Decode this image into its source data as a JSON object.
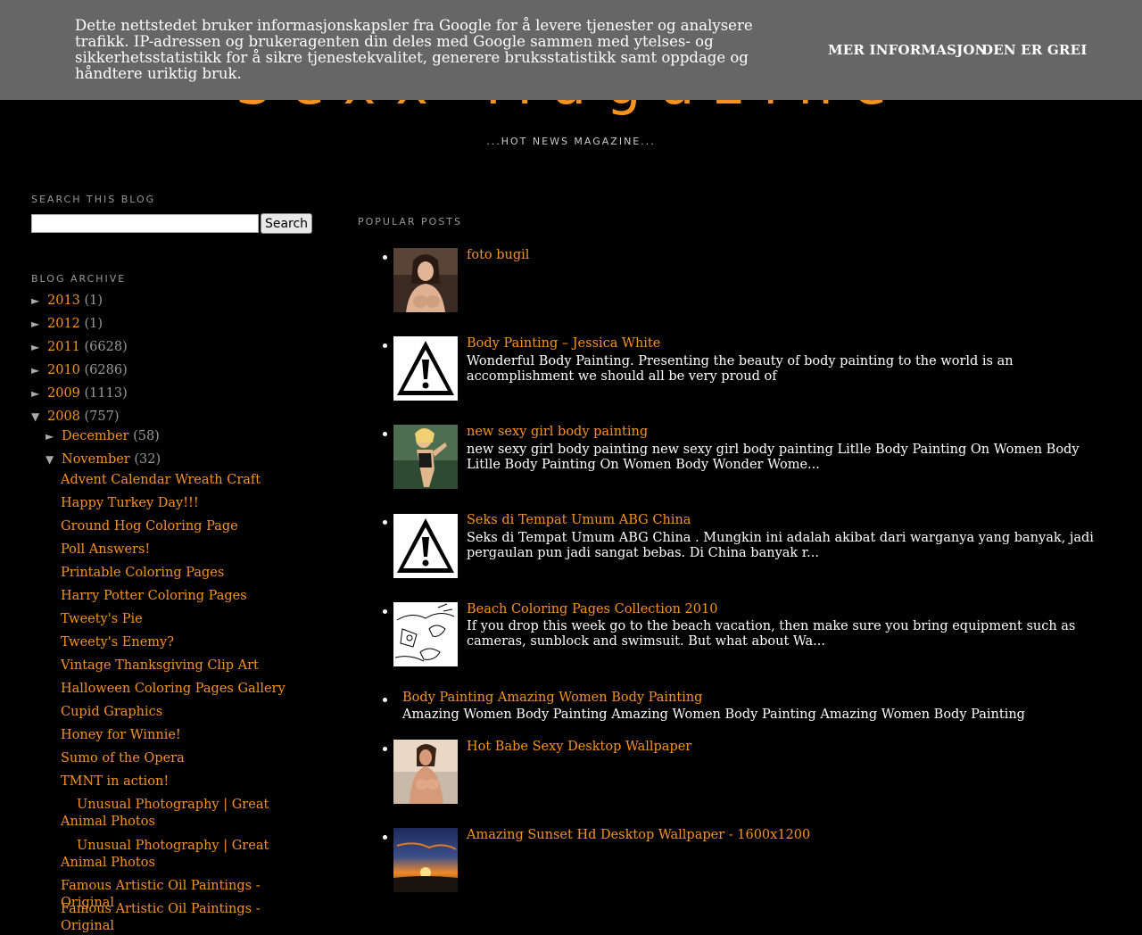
{
  "cookie_banner": {
    "text": "Dette nettstedet bruker informasjonskapsler fra Google for å levere tjenester og analysere trafikk. IP-adressen og brukeragenten din deles med Google sammen med ytelses- og sikkerhetsstatistikk for å sikre tjenestekvalitet, generere bruksstatistikk samt oppdage og håndtere uriktig bruk.",
    "more_info": "MER INFORMASJON",
    "ok": "DEN ER GREI"
  },
  "header": {
    "title": "Sexx Magazine",
    "description": "...HOT NEWS MAGAZINE..."
  },
  "search": {
    "title": "SEARCH THIS BLOG",
    "input_value": "",
    "button": "Search"
  },
  "archive": {
    "title": "BLOG ARCHIVE",
    "years": [
      {
        "toggle": "►",
        "year": "2013",
        "count": "(1)"
      },
      {
        "toggle": "►",
        "year": "2012",
        "count": "(1)"
      },
      {
        "toggle": "►",
        "year": "2011",
        "count": "(6628)"
      },
      {
        "toggle": "►",
        "year": "2010",
        "count": "(6286)"
      },
      {
        "toggle": "►",
        "year": "2009",
        "count": "(1113)"
      },
      {
        "toggle": "▼",
        "year": "2008",
        "count": "(757)"
      }
    ],
    "months": [
      {
        "toggle": "►",
        "month": "December",
        "count": "(58)"
      },
      {
        "toggle": "▼",
        "month": "November",
        "count": "(32)"
      }
    ],
    "posts": [
      "Advent Calendar Wreath Craft",
      "Happy Turkey Day!!!",
      "Ground Hog Coloring Page",
      "Poll Answers!",
      "Printable Coloring Pages",
      "Harry Potter Coloring Pages",
      "Tweety's Pie",
      "Tweety's Enemy?",
      "Vintage Thanksgiving Clip Art",
      "Halloween Coloring Pages Gallery",
      "Cupid Graphics",
      "Honey for Winnie!",
      "Sumo of the Opera",
      "TMNT in action!",
      "Unusual Photography | Great Animal Photos",
      "Unusual Photography | Great Animal Photos",
      "Famous Artistic Oil Paintings - Original",
      "Famous Artistic Oil Paintings - Original"
    ]
  },
  "popular": {
    "title": "POPULAR POSTS",
    "items": [
      {
        "title": "foto bugil",
        "snippet": "",
        "thumb": "photo-thumb"
      },
      {
        "title": "Body Painting – Jessica White",
        "snippet": "Wonderful Body Painting. Presenting the beauty of body painting to the world is an accomplishment we should all be very proud of",
        "thumb": "warning-icon"
      },
      {
        "title": "new sexy girl body painting",
        "snippet": "new sexy girl body painting new sexy girl body painting Litlle Body Painting On Women Body Litlle Body Painting On Women Body Wonder Wome...",
        "thumb": "photo-thumb"
      },
      {
        "title": "Seks di Tempat Umum ABG China",
        "snippet": "Seks di Tempat Umum ABG China . Mungkin ini adalah akibat dari warganya yang banyak, jadi pergaulan pun jadi sangat bebas. Di China banyak r...",
        "thumb": "warning-icon"
      },
      {
        "title": "Beach Coloring Pages Collection 2010",
        "snippet": "If you drop this week go to the beach vacation, then make sure you bring equipment such as cameras, sunblock and swimsuit. But what about Wa...",
        "thumb": "sketch-thumb"
      },
      {
        "title": "Body Painting Amazing Women Body Painting",
        "snippet": "Amazing Women Body Painting Amazing Women Body Painting Amazing Women Body Painting",
        "thumb": ""
      },
      {
        "title": "Hot Babe Sexy Desktop Wallpaper",
        "snippet": "",
        "thumb": "photo-thumb"
      },
      {
        "title": "Amazing Sunset Hd Desktop Wallpaper - 1600x1200",
        "snippet": "",
        "thumb": "sunset-thumb"
      }
    ]
  },
  "colors": {
    "background": "#000000",
    "accent": "#f7931e",
    "banner": "#666666"
  }
}
